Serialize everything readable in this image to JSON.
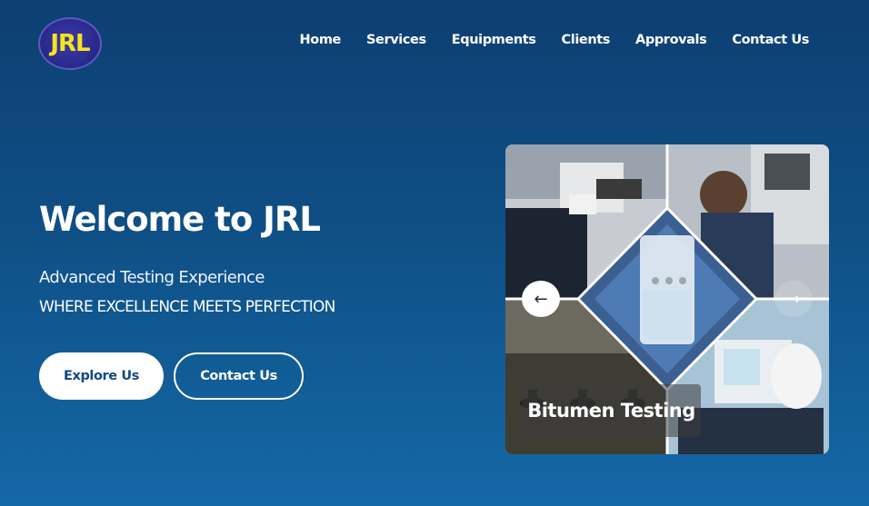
{
  "brand": {
    "logo_text": "JRL"
  },
  "nav": {
    "items": [
      {
        "label": "Home"
      },
      {
        "label": "Services"
      },
      {
        "label": "Equipments"
      },
      {
        "label": "Clients"
      },
      {
        "label": "Approvals"
      },
      {
        "label": "Contact Us"
      }
    ]
  },
  "hero": {
    "title": "Welcome to JRL",
    "subtitle": "Advanced Testing Experience",
    "tagline": "WHERE EXCELLENCE MEETS PERFECTION",
    "primary_button": "Explore Us",
    "secondary_button": "Contact Us"
  },
  "carousel": {
    "caption": "Bitumen Testing",
    "prev_icon": "arrow-left-icon",
    "next_icon": "arrow-right-icon"
  },
  "colors": {
    "background_top": "#0d3f72",
    "background_bottom": "#1468a6",
    "logo_text": "#f2e51c",
    "button_text": "#0f4a80"
  }
}
